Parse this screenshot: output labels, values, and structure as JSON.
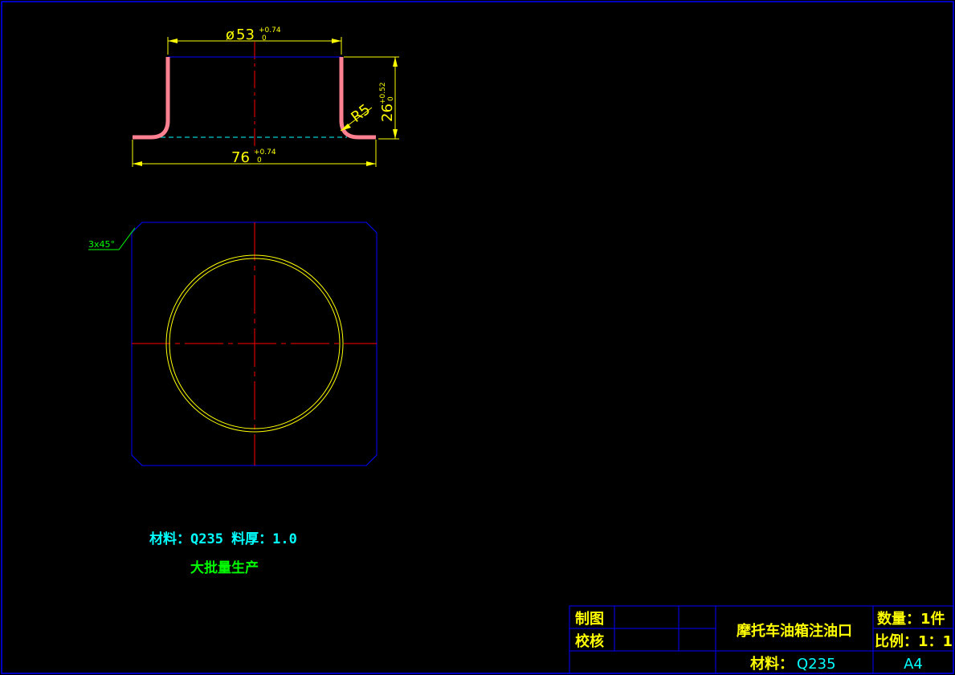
{
  "colors": {
    "background": "#000000",
    "frame": "#0000ff",
    "dimension": "#ffff00",
    "part_profile": "#ff8090",
    "centerline": "#ff0000",
    "hidden_line": "#00ffff",
    "circle": "#ffff00",
    "chamfer_note": "#00ff00",
    "material_note": "#00ffff",
    "production_note": "#00ff00",
    "title_text": "#ffff00",
    "title_value": "#00ffff"
  },
  "section_view": {
    "top_diameter": {
      "symbol": "ø",
      "value": "53",
      "upper_tol": "+0.74",
      "lower_tol": "0"
    },
    "flange_width": {
      "value": "76",
      "upper_tol": "+0.74",
      "lower_tol": "0"
    },
    "height": {
      "value": "26",
      "upper_tol": "+0.52",
      "lower_tol": "0"
    },
    "bend_radius": "R5"
  },
  "plan_view": {
    "chamfer_note": "3x45°"
  },
  "notes": {
    "material_line": "材料：Q235  料厚：1.0",
    "production": "大批量生产"
  },
  "title_block": {
    "drawn_label": "制图",
    "checked_label": "校核",
    "part_name": "摩托车油箱注油口",
    "quantity": "数量：1件",
    "scale": "比例：1：1",
    "material_label": "材料：",
    "material_value": "Q235",
    "sheet_size": "A4"
  }
}
